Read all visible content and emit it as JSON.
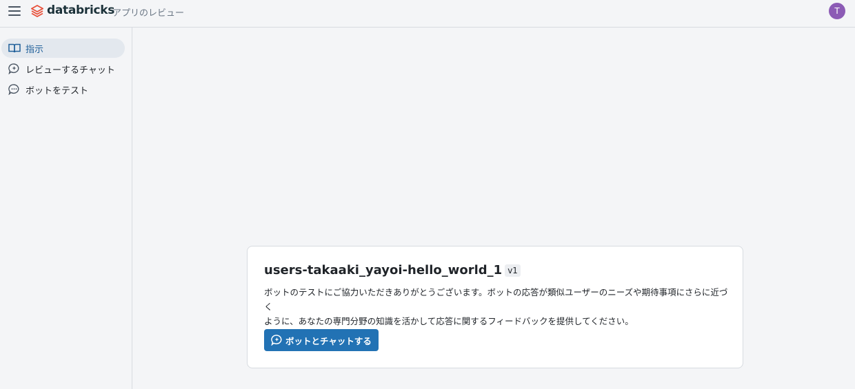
{
  "header": {
    "brand": "databricks",
    "app_title": "アプリのレビュー",
    "avatar_initial": "T",
    "menu_icon": "hamburger-icon",
    "logo_icon": "databricks-logo-icon"
  },
  "sidebar": {
    "items": [
      {
        "label": "指示",
        "icon": "book-icon",
        "active": true
      },
      {
        "label": "レビューするチャット",
        "icon": "chat-sparkle-icon",
        "active": false
      },
      {
        "label": "ボットをテスト",
        "icon": "chat-bubble-icon",
        "active": false
      }
    ]
  },
  "card": {
    "title": "users-takaaki_yayoi-hello_world_1",
    "version": "v1",
    "description_line1": "ボットのテストにご協力いただきありがとうございます。ボットの応答が類似ユーザーのニーズや期待事項にさらに近づく",
    "description_line2": "ように、あなたの専門分野の知識を活かして応答に関するフィードバックを提供してください。",
    "button_label": "ボットとチャットする",
    "button_icon": "chat-sparkle-icon"
  },
  "colors": {
    "accent": "#2272b4",
    "active_nav_text": "#1f5f99",
    "avatar_bg": "#8c5bb5",
    "logo": "#e8503a"
  }
}
